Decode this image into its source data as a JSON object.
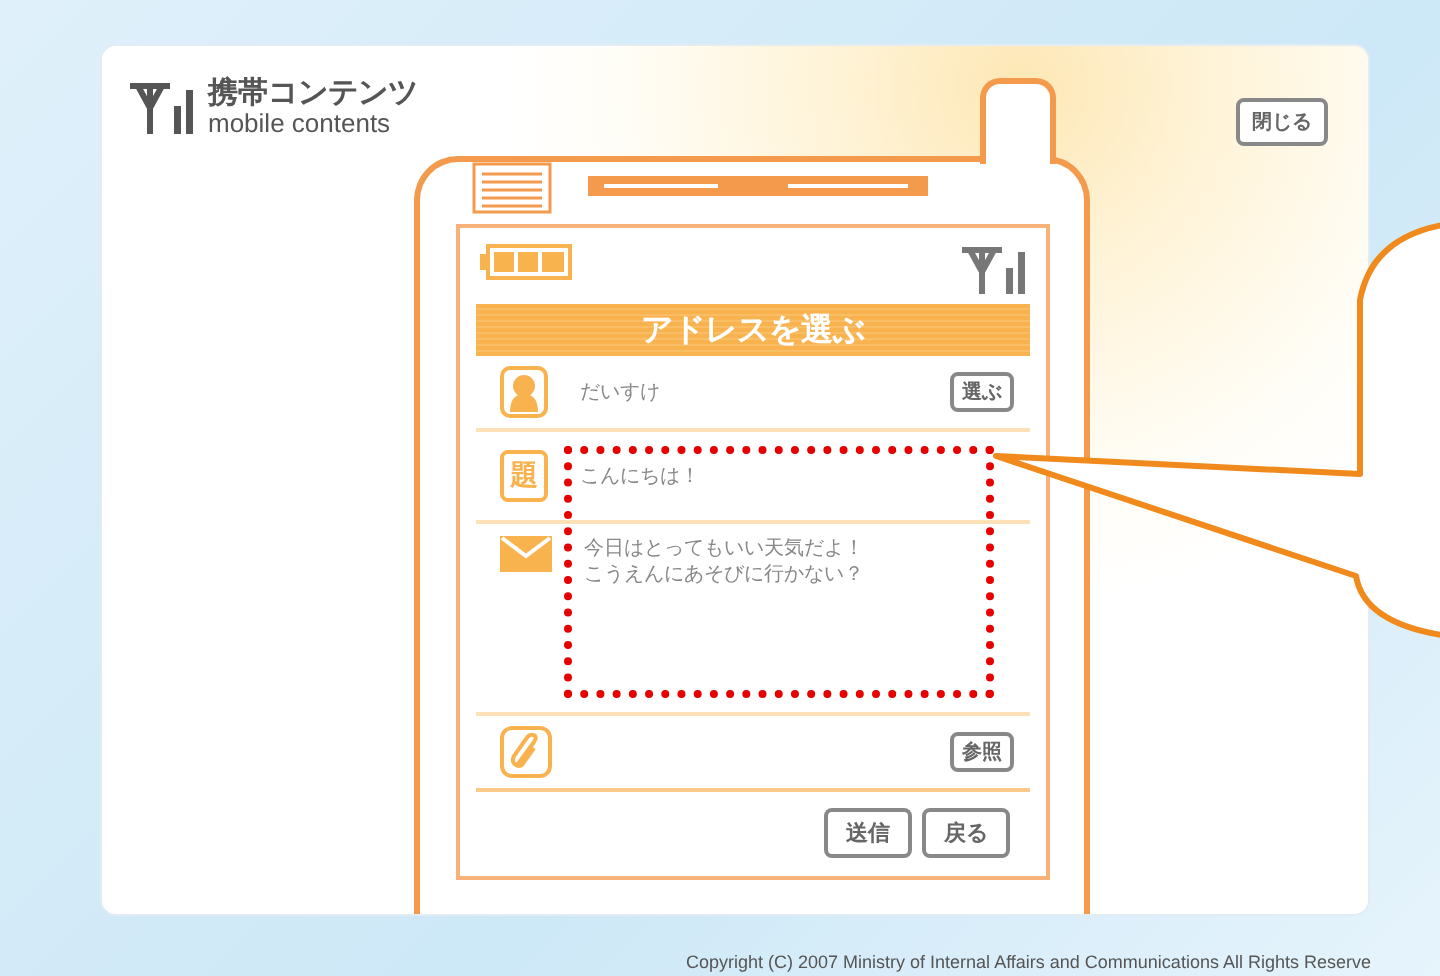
{
  "header": {
    "logo_title": "携帯コンテンツ",
    "logo_subtitle": "mobile contents",
    "close_button": "閉じる"
  },
  "screen": {
    "title": "アドレスを選ぶ",
    "recipient": {
      "name": "だいすけ",
      "button": "選ぶ"
    },
    "subject": {
      "icon_label": "題",
      "text": "こんにちは！"
    },
    "body": {
      "lines": [
        "今日はとってもいい天気だよ！",
        "こうえんにあそびに行かない？"
      ]
    },
    "attachment": {
      "button": "参照"
    },
    "buttons": [
      "送信",
      "戻る"
    ]
  },
  "footer": {
    "copyright": "Copyright (C) 2007 Ministry of Internal Affairs and Communications All Rights Reserve"
  }
}
